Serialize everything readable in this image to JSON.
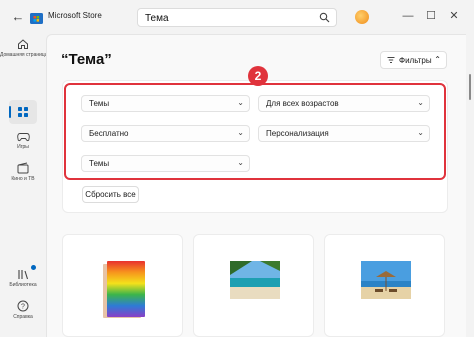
{
  "titlebar": {
    "app_title": "Microsoft Store",
    "search_value": "Тема",
    "back_glyph": "←",
    "minimize_glyph": "—",
    "maximize_glyph": "☐",
    "close_glyph": "✕"
  },
  "sidebar": {
    "items": [
      {
        "label": "Домашняя страница",
        "icon": "home-icon"
      },
      {
        "label": "",
        "icon": "apps-icon"
      },
      {
        "label": "Игры",
        "icon": "gamepad-icon"
      },
      {
        "label": "Кино и ТВ",
        "icon": "film-icon"
      },
      {
        "label": "Библиотека",
        "icon": "library-icon"
      },
      {
        "label": "Справка",
        "icon": "help-icon"
      }
    ]
  },
  "main": {
    "title": "“Тема”",
    "filters_label": "Фильтры",
    "filters_chevron": "⌃",
    "dropdowns": [
      {
        "value": "Темы"
      },
      {
        "value": "Для всех возрастов"
      },
      {
        "value": "Бесплатно"
      },
      {
        "value": "Персонализация"
      },
      {
        "value": "Темы"
      }
    ],
    "dropdown_chevron": "⌄",
    "reset_label": "Сбросить все",
    "step_number": "2"
  },
  "colors": {
    "accent": "#0067c0",
    "highlight": "#e0333c"
  }
}
